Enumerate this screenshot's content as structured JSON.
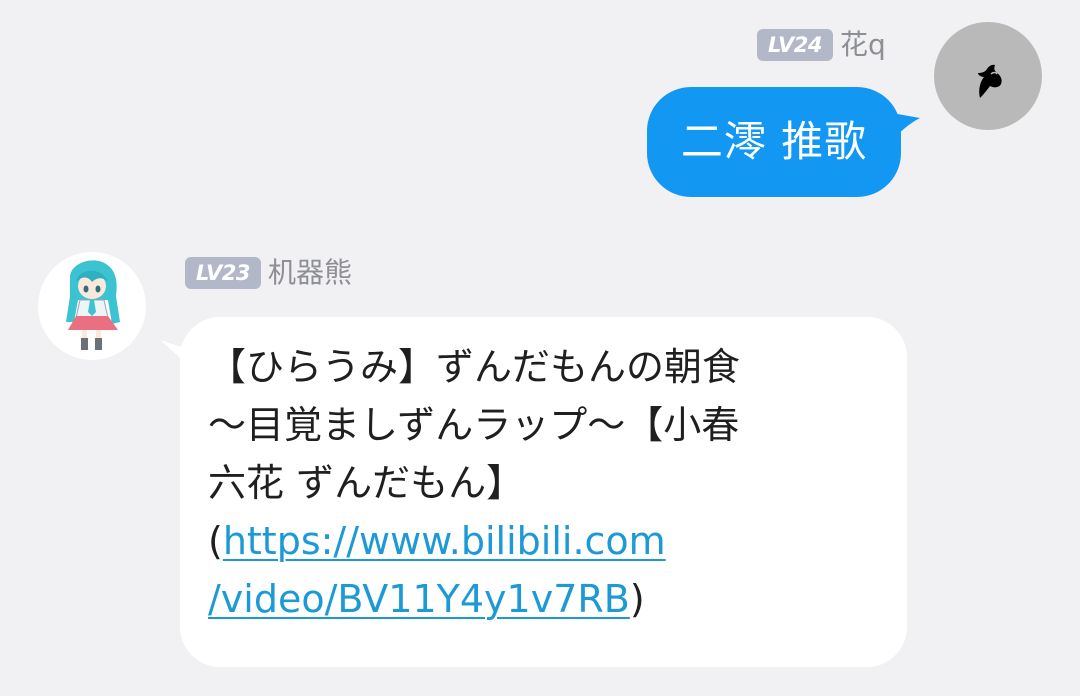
{
  "messages": [
    {
      "direction": "outgoing",
      "sender": {
        "level": "LV24",
        "name": "花q",
        "avatar": "black-bird-silhouette-avatar"
      },
      "text": "二澪 推歌",
      "bubble_color": "#1297f3"
    },
    {
      "direction": "incoming",
      "sender": {
        "level": "LV23",
        "name": "机器熊",
        "avatar": "anime-girl-teal-hair-avatar"
      },
      "lines": [
        "【ひらうみ】ずんだもんの朝食",
        "〜目覚ましずんラップ〜【小春",
        "六花 ずんだもん】"
      ],
      "link_open": "(",
      "link_line1": "https://www.bilibili.com",
      "link_line2": "/video/BV11Y4y1v7RB",
      "link_close": ")",
      "link_color": "#1d9ad6",
      "bubble_color": "#ffffff"
    }
  ],
  "colors": {
    "background": "#f1f1f3",
    "level_badge": "#b2b8c8",
    "nickname": "#8d8f95"
  }
}
